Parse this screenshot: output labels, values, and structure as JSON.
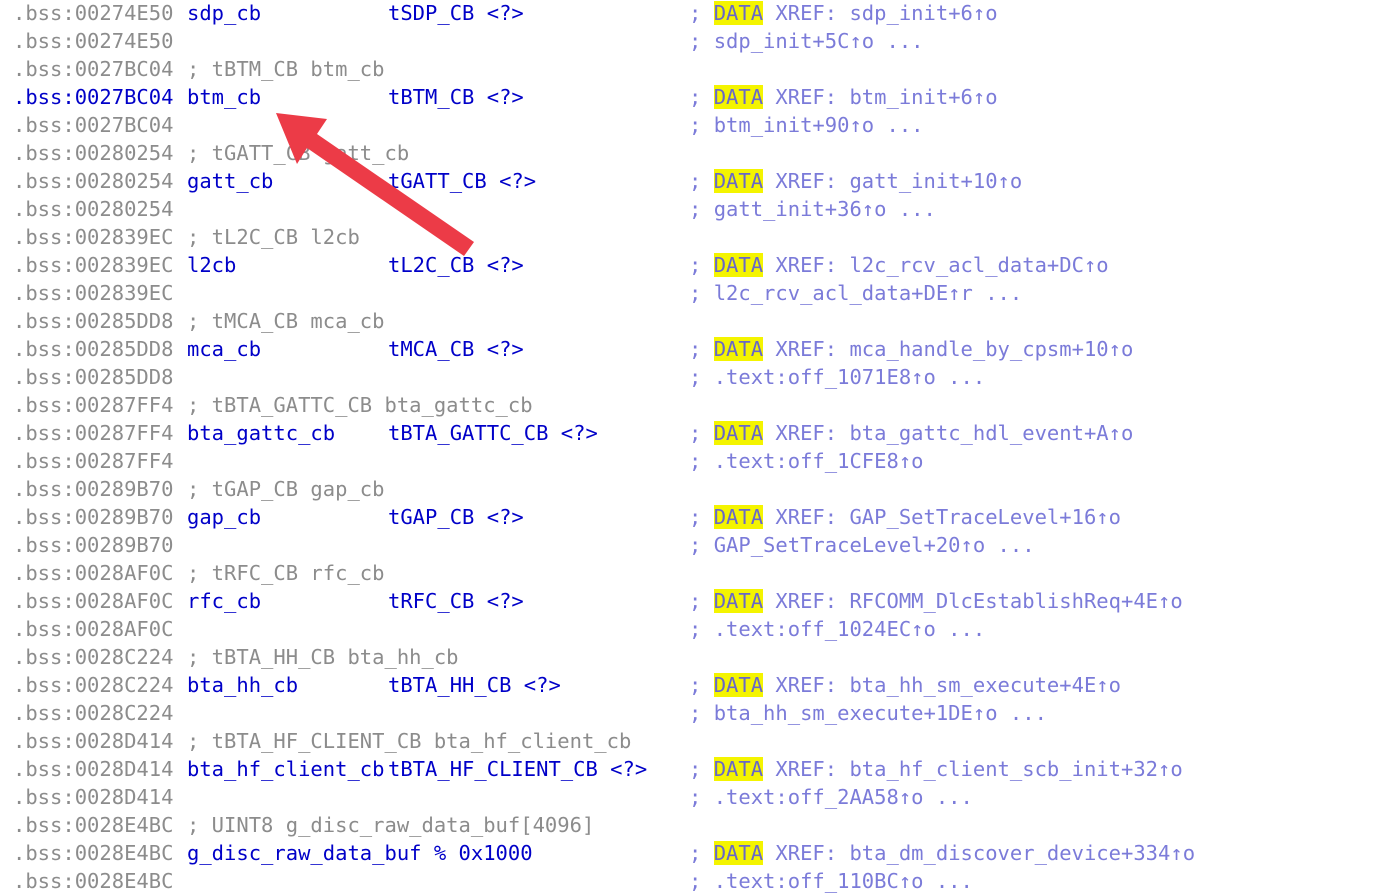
{
  "listing": {
    "lines": [
      {
        "addr": ".bss:00274E50",
        "name": "sdp_cb",
        "type": "tSDP_CB <?>",
        "xref_hl": "DATA",
        "xref": " XREF: sdp_init+6↑o"
      },
      {
        "addr": ".bss:00274E50",
        "xref": "sdp_init+5C↑o ..."
      },
      {
        "addr": ".bss:0027BC04",
        "comment": "; tBTM_CB btm_cb"
      },
      {
        "addr": ".bss:0027BC04",
        "name": "btm_cb",
        "type": "tBTM_CB <?>",
        "xref_hl": "DATA",
        "xref": " XREF: btm_init+6↑o",
        "current": true
      },
      {
        "addr": ".bss:0027BC04",
        "xref": "btm_init+90↑o ..."
      },
      {
        "addr": ".bss:00280254",
        "comment": "; tGATT_CB gatt_cb"
      },
      {
        "addr": ".bss:00280254",
        "name": "gatt_cb",
        "type": "tGATT_CB <?>",
        "xref_hl": "DATA",
        "xref": " XREF: gatt_init+10↑o"
      },
      {
        "addr": ".bss:00280254",
        "xref": "gatt_init+36↑o ..."
      },
      {
        "addr": ".bss:002839EC",
        "comment": "; tL2C_CB l2cb"
      },
      {
        "addr": ".bss:002839EC",
        "name": "l2cb",
        "type": "tL2C_CB <?>",
        "xref_hl": "DATA",
        "xref": " XREF: l2c_rcv_acl_data+DC↑o"
      },
      {
        "addr": ".bss:002839EC",
        "xref": "l2c_rcv_acl_data+DE↑r ..."
      },
      {
        "addr": ".bss:00285DD8",
        "comment": "; tMCA_CB mca_cb"
      },
      {
        "addr": ".bss:00285DD8",
        "name": "mca_cb",
        "type": "tMCA_CB <?>",
        "xref_hl": "DATA",
        "xref": " XREF: mca_handle_by_cpsm+10↑o"
      },
      {
        "addr": ".bss:00285DD8",
        "xref": ".text:off_1071E8↑o ..."
      },
      {
        "addr": ".bss:00287FF4",
        "comment": "; tBTA_GATTC_CB bta_gattc_cb"
      },
      {
        "addr": ".bss:00287FF4",
        "name": "bta_gattc_cb",
        "type": "tBTA_GATTC_CB <?>",
        "xref_hl": "DATA",
        "xref": " XREF: bta_gattc_hdl_event+A↑o"
      },
      {
        "addr": ".bss:00287FF4",
        "xref": ".text:off_1CFE8↑o"
      },
      {
        "addr": ".bss:00289B70",
        "comment": "; tGAP_CB gap_cb"
      },
      {
        "addr": ".bss:00289B70",
        "name": "gap_cb",
        "type": "tGAP_CB <?>",
        "xref_hl": "DATA",
        "xref": " XREF: GAP_SetTraceLevel+16↑o"
      },
      {
        "addr": ".bss:00289B70",
        "xref": "GAP_SetTraceLevel+20↑o ..."
      },
      {
        "addr": ".bss:0028AF0C",
        "comment": "; tRFC_CB rfc_cb"
      },
      {
        "addr": ".bss:0028AF0C",
        "name": "rfc_cb",
        "type": "tRFC_CB <?>",
        "xref_hl": "DATA",
        "xref": " XREF: RFCOMM_DlcEstablishReq+4E↑o"
      },
      {
        "addr": ".bss:0028AF0C",
        "xref": ".text:off_1024EC↑o ..."
      },
      {
        "addr": ".bss:0028C224",
        "comment": "; tBTA_HH_CB bta_hh_cb"
      },
      {
        "addr": ".bss:0028C224",
        "name": "bta_hh_cb",
        "type": "tBTA_HH_CB <?>",
        "xref_hl": "DATA",
        "xref": " XREF: bta_hh_sm_execute+4E↑o"
      },
      {
        "addr": ".bss:0028C224",
        "xref": "bta_hh_sm_execute+1DE↑o ..."
      },
      {
        "addr": ".bss:0028D414",
        "comment": "; tBTA_HF_CLIENT_CB bta_hf_client_cb"
      },
      {
        "addr": ".bss:0028D414",
        "name": "bta_hf_client_cb",
        "type": "tBTA_HF_CLIENT_CB <?>",
        "xref_hl": "DATA",
        "xref": " XREF: bta_hf_client_scb_init+32↑o"
      },
      {
        "addr": ".bss:0028D414",
        "xref": ".text:off_2AA58↑o ..."
      },
      {
        "addr": ".bss:0028E4BC",
        "comment": "; UINT8 g_disc_raw_data_buf[4096]"
      },
      {
        "addr": ".bss:0028E4BC",
        "name": "g_disc_raw_data_buf % 0x1000",
        "xref_hl": "DATA",
        "xref": " XREF: bta_dm_discover_device+334↑o"
      },
      {
        "addr": ".bss:0028E4BC",
        "xref": ".text:off_110BC↑o ..."
      }
    ]
  },
  "colors": {
    "address": "#8c8c8c",
    "current_address": "#0000c8",
    "name": "#0000c8",
    "xref": "#7b7bd9",
    "highlight": "#f4f400",
    "arrow": "#ec3b47"
  }
}
